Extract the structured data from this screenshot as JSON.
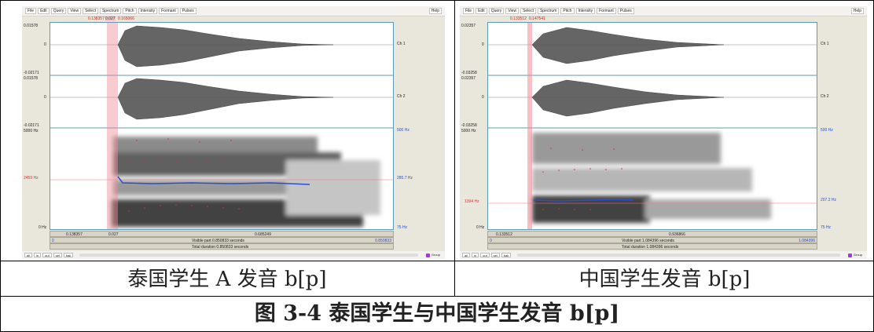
{
  "left": {
    "menu": [
      "File",
      "Edit",
      "Query",
      "View",
      "Select",
      "Spectrum",
      "Pitch",
      "Intensity",
      "Formant",
      "Pulses"
    ],
    "help": "Help",
    "selection_readout": [
      "0.138357",
      "0.027",
      "0.165066"
    ],
    "ch1": {
      "top": "0.01578",
      "zero": "0",
      "bottom": "-0.02171",
      "label": "Ch 1"
    },
    "ch2": {
      "top": "0.01578",
      "zero": "0",
      "bottom": "-0.02171",
      "label": "Ch 2"
    },
    "spectrogram": {
      "top": "5000 Hz",
      "cursor": "2459 Hz",
      "bottom": "0 Hz",
      "right_top": "500 Hz",
      "right_mid": "285.7 Hz",
      "right_bottom": "75 Hz"
    },
    "time_row1": [
      "0.138357",
      "0.027",
      "0.685249"
    ],
    "time_row2": [
      "0",
      "Visible part 0.850833 seconds",
      "0.850833"
    ],
    "time_row3": "Total duration 0.850833 seconds",
    "buttons": [
      "all",
      "in",
      "out",
      "sel",
      "bak"
    ],
    "group": "Group",
    "caption": "泰国学生 A 发音 b[p]"
  },
  "right": {
    "menu": [
      "File",
      "Edit",
      "Query",
      "View",
      "Select",
      "Spectrum",
      "Pitch",
      "Intensity",
      "Formant",
      "Pulses"
    ],
    "help": "Help",
    "selection_readout": [
      "0.133512",
      "0.147541"
    ],
    "ch1": {
      "top": "0.02357",
      "zero": "0",
      "bottom": "-0.03258",
      "label": "Ch 1"
    },
    "ch2": {
      "top": "0.02357",
      "zero": "0",
      "bottom": "-0.03258",
      "label": "Ch 2"
    },
    "spectrogram": {
      "top": "5000 Hz",
      "cursor": "1394 Hz",
      "bottom": "0 Hz",
      "right_top": "500 Hz",
      "right_mid": "207.2 Hz",
      "right_bottom": "75 Hz"
    },
    "time_row1": [
      "0.133512",
      "0.936866"
    ],
    "time_row2": [
      "0",
      "Visible part 1.084396 seconds",
      "1.084396"
    ],
    "time_row3": "Total duration 1.084396 seconds",
    "buttons": [
      "all",
      "in",
      "out",
      "sel",
      "bak"
    ],
    "group": "Group",
    "caption": "中国学生发音 b[p]"
  },
  "figure_caption": "图 3-4 泰国学生与中国学生发音 b[p]",
  "colors": {
    "frame": "#5e98b8",
    "selection": "#f08c96",
    "pitch": "#2a4fd0",
    "formant": "#d33"
  }
}
